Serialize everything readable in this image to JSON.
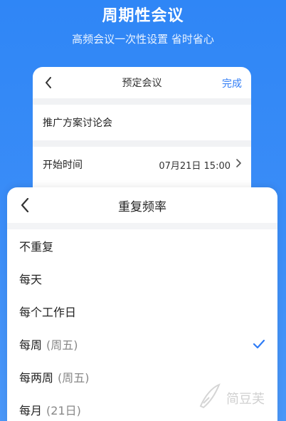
{
  "hero": {
    "title": "周期性会议",
    "subtitle": "高频会议一次性设置 省时省心"
  },
  "back_card": {
    "title": "预定会议",
    "done_label": "完成",
    "meeting_name": "推广方案讨论会",
    "start_time_label": "开始时间",
    "start_time_value": "07月21日 15:00"
  },
  "sheet": {
    "title": "重复频率",
    "options": [
      {
        "label": "不重复",
        "extra": ""
      },
      {
        "label": "每天",
        "extra": ""
      },
      {
        "label": "每个工作日",
        "extra": ""
      },
      {
        "label": "每周",
        "extra": "(周五)",
        "selected": true
      },
      {
        "label": "每两周",
        "extra": "(周五)"
      },
      {
        "label": "每月",
        "extra": "(21日)"
      }
    ]
  },
  "watermark": {
    "text": "简豆芙"
  },
  "colors": {
    "accent": "#2f7cf6",
    "background": "#2f86f6"
  },
  "icons": {
    "back": "chevron-left-icon",
    "next": "chevron-right-icon",
    "selected": "check-icon"
  }
}
